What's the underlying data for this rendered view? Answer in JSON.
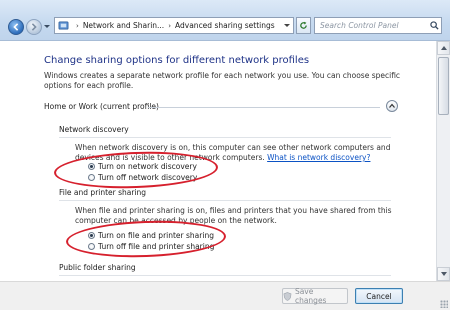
{
  "nav": {
    "breadcrumb": [
      "Network and Sharin...",
      "Advanced sharing settings"
    ],
    "search_placeholder": "Search Control Panel"
  },
  "page": {
    "title": "Change sharing options for different network profiles",
    "intro": "Windows creates a separate network profile for each network you use. You can choose specific options for each profile."
  },
  "profile": {
    "label": "Home or Work (current profile)",
    "expanded": true
  },
  "network_discovery": {
    "title": "Network discovery",
    "description": "When network discovery is on, this computer can see other network computers and devices and is visible to other network computers.",
    "link": "What is network discovery?",
    "options": [
      {
        "label": "Turn on network discovery",
        "selected": true
      },
      {
        "label": "Turn off network discovery",
        "selected": false
      }
    ]
  },
  "file_printer_sharing": {
    "title": "File and printer sharing",
    "description": "When file and printer sharing is on, files and printers that you have shared from this computer can be accessed by people on the network.",
    "options": [
      {
        "label": "Turn on file and printer sharing",
        "selected": true
      },
      {
        "label": "Turn off file and printer sharing",
        "selected": false
      }
    ]
  },
  "public_folder": {
    "title": "Public folder sharing"
  },
  "footer": {
    "save_label": "Save changes",
    "cancel_label": "Cancel"
  },
  "colors": {
    "highlight_oval": "#d6202d",
    "title_blue": "#1e3287",
    "link_blue": "#0b52c4"
  }
}
